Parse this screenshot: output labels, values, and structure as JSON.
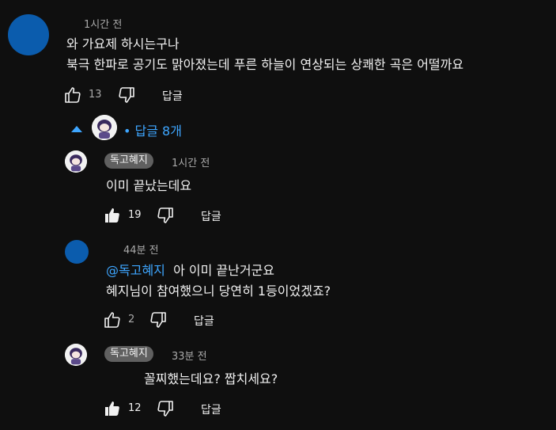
{
  "comment": {
    "time": "1시간 전",
    "line1": "와 가요제 하시는구나",
    "line2": "북극 한파로 공기도 맑아졌는데 푸른 하늘이 연상되는 상쾌한 곡은 어떨까요",
    "likes": "13",
    "reply_label": "답글"
  },
  "replies_toggle": {
    "label": "• 답글 8개"
  },
  "replies": [
    {
      "author": "독고혜지",
      "time": "1시간 전",
      "text": "이미 끝났는데요",
      "likes": "19",
      "reply_label": "답글"
    },
    {
      "time": "44분 전",
      "mention": "@독고혜지",
      "text1": "아 이미 끝난거군요",
      "text2": "혜지님이 참여했으니 당연히 1등이었겠죠?",
      "likes": "2",
      "reply_label": "답글"
    },
    {
      "author": "독고혜지",
      "time": "33분 전",
      "text": "꼴찌했는데요? 짭치세요?",
      "likes": "12",
      "reply_label": "답글"
    }
  ],
  "colors": {
    "background": "#0f0f0f",
    "accent": "#3ea6ff",
    "avatar_blue": "#0b5cad",
    "chip_bg": "#606060"
  }
}
